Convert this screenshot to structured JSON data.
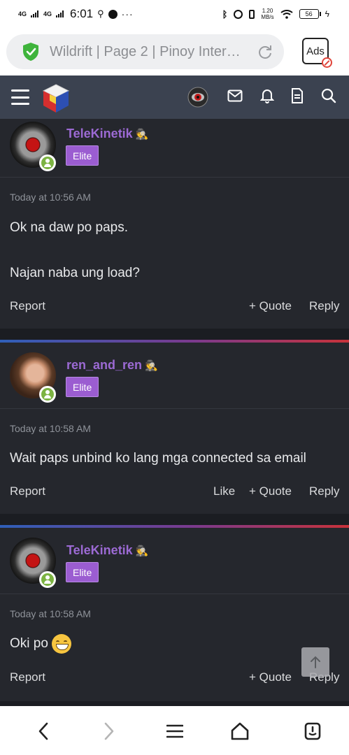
{
  "status_bar": {
    "net1": "4G",
    "net2": "4G",
    "time": "6:01",
    "speed_value": "1.20",
    "speed_unit": "MB/s",
    "battery": "56"
  },
  "browser": {
    "url_text": "Wildrift | Page 2 | Pinoy Inter…",
    "ads_label": "Ads"
  },
  "posts": [
    {
      "username": "TeleKinetik",
      "badge": "Elite",
      "time": "Today at 10:56 AM",
      "lines": [
        "Ok na daw po paps.",
        "Najan naba ung load?"
      ],
      "actions": {
        "report": "Report",
        "quote": "Quote",
        "reply": "Reply"
      }
    },
    {
      "username": "ren_and_ren",
      "badge": "Elite",
      "time": "Today at 10:58 AM",
      "lines": [
        "Wait paps unbind ko lang mga connected sa email"
      ],
      "actions": {
        "report": "Report",
        "like": "Like",
        "quote": "Quote",
        "reply": "Reply"
      }
    },
    {
      "username": "TeleKinetik",
      "badge": "Elite",
      "time": "Today at 10:58 AM",
      "lines": [
        "Oki po"
      ],
      "emoji": "grinning-face",
      "actions": {
        "report": "Report",
        "quote": "Quote",
        "reply": "Reply"
      }
    }
  ],
  "colors": {
    "username": "#9c6ad4",
    "badge": "#9b5dd1",
    "header": "#3b4250",
    "post_bg": "#25272d"
  }
}
